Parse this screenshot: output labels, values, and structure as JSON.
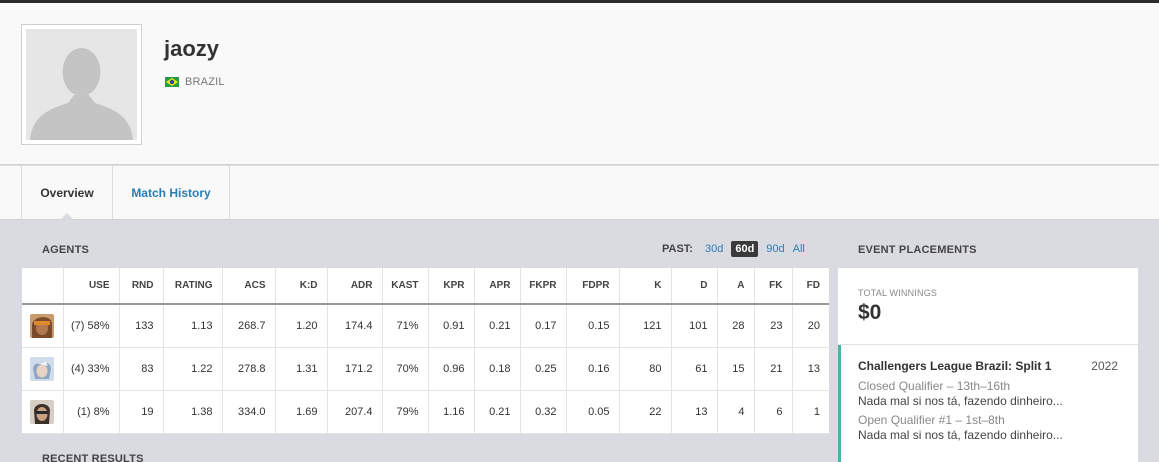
{
  "player": {
    "name": "jaozy",
    "country": "BRAZIL",
    "flag_colors": {
      "green": "#229e45",
      "yellow": "#f8e509",
      "blue": "#2b49a3"
    }
  },
  "tabs": [
    {
      "label": "Overview",
      "active": true
    },
    {
      "label": "Match History",
      "active": false
    }
  ],
  "agents": {
    "title": "AGENTS",
    "past_label": "PAST:",
    "past_options": [
      "30d",
      "60d",
      "90d",
      "All"
    ],
    "past_selected": "60d",
    "columns": [
      "USE",
      "RND",
      "RATING",
      "ACS",
      "K:D",
      "ADR",
      "KAST",
      "KPR",
      "APR",
      "FKPR",
      "FDPR",
      "K",
      "D",
      "A",
      "FK",
      "FD"
    ],
    "rows": [
      {
        "icon": "agent-raze-icon",
        "cells": [
          "(7) 58%",
          "133",
          "1.13",
          "268.7",
          "1.20",
          "174.4",
          "71%",
          "0.91",
          "0.21",
          "0.17",
          "0.15",
          "121",
          "101",
          "28",
          "23",
          "20"
        ]
      },
      {
        "icon": "agent-jett-icon",
        "cells": [
          "(4) 33%",
          "83",
          "1.22",
          "278.8",
          "1.31",
          "171.2",
          "70%",
          "0.96",
          "0.18",
          "0.25",
          "0.16",
          "80",
          "61",
          "15",
          "21",
          "13"
        ]
      },
      {
        "icon": "agent-chamber-icon",
        "cells": [
          "(1) 8%",
          "19",
          "1.38",
          "334.0",
          "1.69",
          "207.4",
          "79%",
          "1.16",
          "0.21",
          "0.32",
          "0.05",
          "22",
          "13",
          "4",
          "6",
          "1"
        ]
      }
    ]
  },
  "events": {
    "title": "EVENT PLACEMENTS",
    "total_label": "TOTAL WINNINGS",
    "total_value": "$0",
    "placements": [
      {
        "event": "Challengers League Brazil: Split 1",
        "year": "2022",
        "accent": "#4fb3a2",
        "results": [
          {
            "stage": "Closed Qualifier – 13th–16th",
            "team": "Nada mal si nos tá, fazendo dinheiro..."
          },
          {
            "stage": "Open Qualifier #1 – 1st–8th",
            "team": "Nada mal si nos tá, fazendo dinheiro..."
          }
        ]
      }
    ]
  },
  "recent_results": {
    "title": "RECENT RESULTS"
  }
}
